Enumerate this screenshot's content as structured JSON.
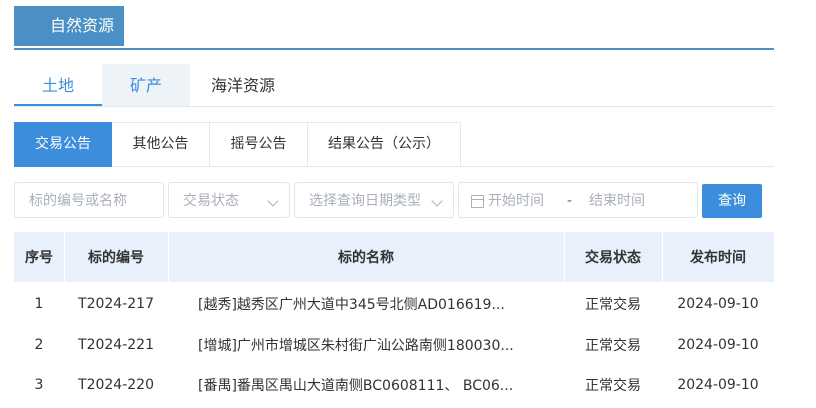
{
  "header": {
    "title": "自然资源"
  },
  "category_tabs": [
    {
      "label": "土地",
      "active": true
    },
    {
      "label": "矿产",
      "active": false
    },
    {
      "label": "海洋资源",
      "active": false
    }
  ],
  "sub_tabs": [
    {
      "label": "交易公告",
      "active": true
    },
    {
      "label": "其他公告",
      "active": false
    },
    {
      "label": "摇号公告",
      "active": false
    },
    {
      "label": "结果公告（公示）",
      "active": false
    }
  ],
  "filters": {
    "keyword_placeholder": "标的编号或名称",
    "status_placeholder": "交易状态",
    "date_type_placeholder": "选择查询日期类型",
    "start_placeholder": "开始时间",
    "range_separator": "-",
    "end_placeholder": "结束时间",
    "search_label": "查询"
  },
  "table": {
    "columns": [
      "序号",
      "标的编号",
      "标的名称",
      "交易状态",
      "发布时间"
    ],
    "rows": [
      [
        "1",
        "T2024-217",
        "[越秀]越秀区广州大道中345号北侧AD016619...",
        "正常交易",
        "2024-09-10"
      ],
      [
        "2",
        "T2024-221",
        "[增城]广州市增城区朱村街广汕公路南侧180030...",
        "正常交易",
        "2024-09-10"
      ],
      [
        "3",
        "T2024-220",
        "[番禺]番禺区禺山大道南侧BC0608111、 BC06...",
        "正常交易",
        "2024-09-10"
      ]
    ]
  },
  "colors": {
    "accent": "#3c8ddb",
    "header_bg": "#4a90c4",
    "table_head_bg": "#e8f1fb"
  }
}
